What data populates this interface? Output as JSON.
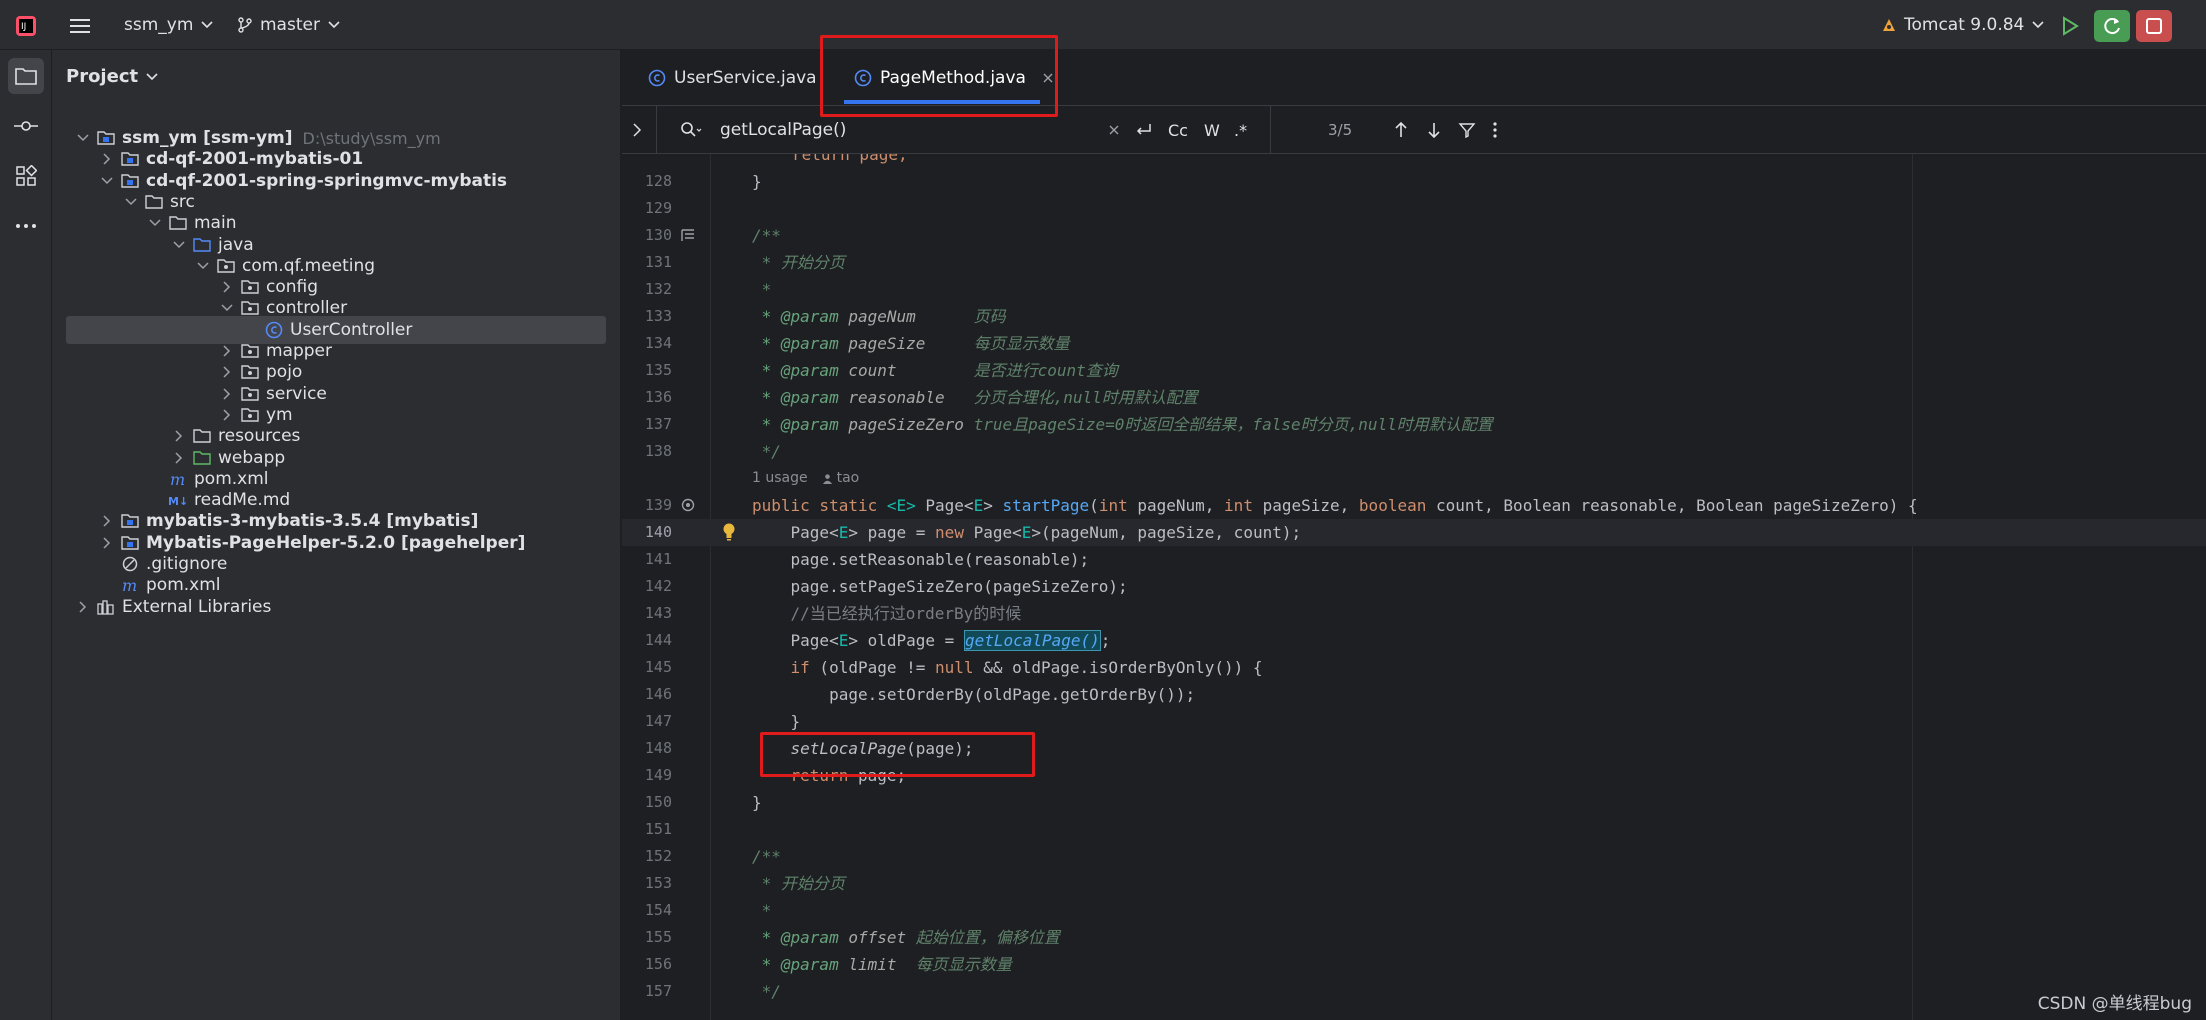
{
  "titlebar": {
    "project_name": "ssm_ym",
    "branch": "master",
    "run_config": "Tomcat 9.0.84"
  },
  "project_panel": {
    "title": "Project",
    "tree": [
      {
        "label": "ssm_ym [ssm-ym]",
        "path": "D:\\study\\ssm_ym",
        "type": "module",
        "expanded": true
      },
      {
        "label": "cd-qf-2001-mybatis-01",
        "type": "module",
        "expanded": false
      },
      {
        "label": "cd-qf-2001-spring-springmvc-mybatis",
        "type": "module",
        "expanded": true
      },
      {
        "label": "src",
        "type": "folder",
        "expanded": true
      },
      {
        "label": "main",
        "type": "folder",
        "expanded": true
      },
      {
        "label": "java",
        "type": "source-folder",
        "expanded": true
      },
      {
        "label": "com.qf.meeting",
        "type": "package",
        "expanded": true
      },
      {
        "label": "config",
        "type": "package",
        "expanded": false
      },
      {
        "label": "controller",
        "type": "package",
        "expanded": true
      },
      {
        "label": "UserController",
        "type": "class",
        "selected": true
      },
      {
        "label": "mapper",
        "type": "package",
        "expanded": false
      },
      {
        "label": "pojo",
        "type": "package",
        "expanded": false
      },
      {
        "label": "service",
        "type": "package",
        "expanded": false
      },
      {
        "label": "ym",
        "type": "package",
        "expanded": false
      },
      {
        "label": "resources",
        "type": "resources-folder",
        "expanded": false
      },
      {
        "label": "webapp",
        "type": "web-folder",
        "expanded": false
      },
      {
        "label": "pom.xml",
        "type": "maven-file"
      },
      {
        "label": "readMe.md",
        "type": "markdown-file"
      },
      {
        "label": "mybatis-3-mybatis-3.5.4 [mybatis]",
        "type": "module",
        "expanded": false
      },
      {
        "label": "Mybatis-PageHelper-5.2.0 [pagehelper]",
        "type": "module",
        "expanded": false
      },
      {
        "label": ".gitignore",
        "type": "ignore-file"
      },
      {
        "label": "pom.xml",
        "type": "maven-file"
      },
      {
        "label": "External Libraries",
        "type": "libraries",
        "expanded": false
      }
    ]
  },
  "editor": {
    "tabs": [
      {
        "label": "UserService.java",
        "active": false
      },
      {
        "label": "PageMethod.java",
        "active": true
      }
    ],
    "find": {
      "query": "getLocalPage()",
      "match_count": "3/5",
      "opt_case": "Cc",
      "opt_word": "W",
      "opt_regex": ".*"
    },
    "top_partial": "return page;",
    "inlay_usage": "1 usage",
    "inlay_author": "tao",
    "line_numbers": {
      "n128": "128",
      "n129": "129",
      "n130": "130",
      "n131": "131",
      "n132": "132",
      "n133": "133",
      "n134": "134",
      "n135": "135",
      "n136": "136",
      "n137": "137",
      "n138": "138",
      "n139": "139",
      "n140": "140",
      "n141": "141",
      "n142": "142",
      "n143": "143",
      "n144": "144",
      "n145": "145",
      "n146": "146",
      "n147": "147",
      "n148": "148",
      "n149": "149",
      "n150": "150",
      "n151": "151",
      "n152": "152",
      "n153": "153",
      "n154": "154",
      "n155": "155",
      "n156": "156",
      "n157": "157"
    },
    "code": {
      "l128": "}",
      "l130": "/**",
      "l131": " * 开始分页",
      "l132": " *",
      "l133_tag": " * @param",
      "l133_name": " pageNum",
      "l133_desc": "      页码",
      "l134_tag": " * @param",
      "l134_name": " pageSize",
      "l134_desc": "     每页显示数量",
      "l135_tag": " * @param",
      "l135_name": " count",
      "l135_desc": "        是否进行count查询",
      "l136_tag": " * @param",
      "l136_name": " reasonable",
      "l136_desc": "   分页合理化,null时用默认配置",
      "l137_tag": " * @param",
      "l137_name": " pageSizeZero",
      "l137_desc": " true且pageSize=0时返回全部结果，false时分页,null时用默认配置",
      "l138": " */",
      "l139_a": "public static ",
      "l139_b": "<E>",
      "l139_c": " Page<",
      "l139_d": "E",
      "l139_e": "> ",
      "l139_f": "startPage",
      "l139_g": "(",
      "l139_h": "int",
      "l139_i": " pageNum, ",
      "l139_j": "int",
      "l139_k": " pageSize, ",
      "l139_l": "boolean",
      "l139_m": " count, Boolean reasonable, Boolean pageSizeZero) {",
      "l140_a": "    Page<",
      "l140_b": "E",
      "l140_c": "> page = ",
      "l140_d": "new",
      "l140_e": " Page<",
      "l140_f": "E",
      "l140_g": ">(pageNum, pageSize, count);",
      "l141": "    page.setReasonable(reasonable);",
      "l142": "    page.setPageSizeZero(pageSizeZero);",
      "l143": "    //当已经执行过orderBy的时候",
      "l144_a": "    Page<",
      "l144_b": "E",
      "l144_c": "> oldPage = ",
      "l144_d": "getLocalPage()",
      "l144_e": ";",
      "l145_a": "    ",
      "l145_b": "if",
      "l145_c": " (oldPage != ",
      "l145_d": "null",
      "l145_e": " && oldPage.isOrderByOnly()) {",
      "l146": "        page.setOrderBy(oldPage.getOrderBy());",
      "l147": "    }",
      "l148_a": "    ",
      "l148_b": "setLocalPage",
      "l148_c": "(page);",
      "l149_a": "    ",
      "l149_b": "return",
      "l149_c": " page;",
      "l150": "}",
      "l152": "/**",
      "l153": " * 开始分页",
      "l154": " *",
      "l155_tag": " * @param",
      "l155_name": " offset",
      "l155_desc": " 起始位置，偏移位置",
      "l156_tag": " * @param",
      "l156_name": " limit",
      "l156_desc": "  每页显示数量",
      "l157": " */"
    }
  },
  "watermark": "CSDN @单线程bug",
  "colors": {
    "background": "#1e1f22",
    "panel": "#2b2d30",
    "keyword": "#cf8e6d",
    "function": "#56a8f5",
    "doc_comment": "#5f826b",
    "annotation_box": "#e01b1b",
    "run_green": "#499c54",
    "stop_red": "#c94f4f"
  }
}
